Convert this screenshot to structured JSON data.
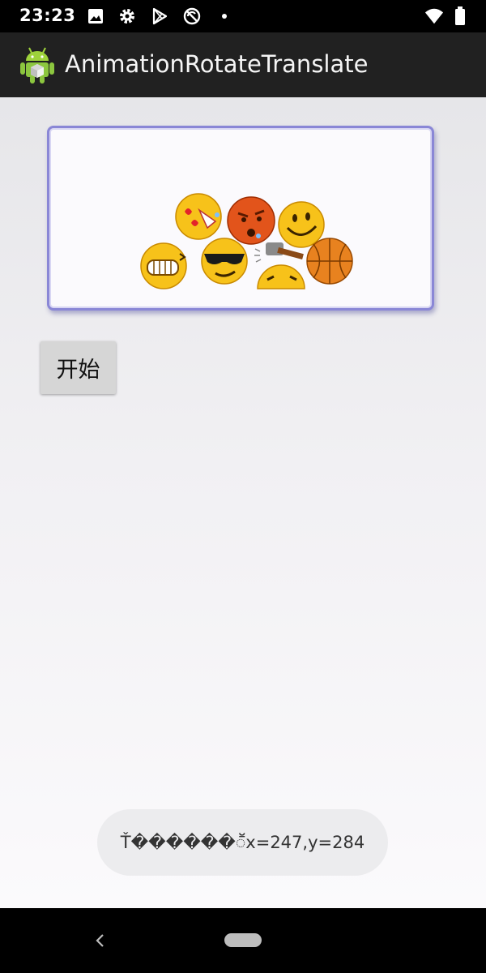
{
  "status_bar": {
    "time": "23:23",
    "left_icons": [
      "image-icon",
      "gear-icon",
      "play-store-icon",
      "no-sync-icon",
      "dot-icon"
    ],
    "right_icons": [
      "wifi-icon",
      "battery-icon"
    ]
  },
  "app_bar": {
    "title": "AnimationRotateTranslate",
    "logo": "android-logo-icon"
  },
  "main": {
    "image_frame": {
      "emojis": [
        "in-love-emoji",
        "angry-emoji",
        "smile-emoji",
        "grin-emoji",
        "cool-sunglasses-emoji",
        "hammer-hit-emoji",
        "basketball-emoji"
      ]
    },
    "start_button_label": "开始"
  },
  "toast": {
    "text": "Ť������ॕx=247,y=284"
  },
  "nav_bar": {
    "back": "back-icon",
    "home": "home-pill-icon"
  },
  "colors": {
    "status_bar": "#000000",
    "app_bar": "#212121",
    "frame_border": "#8a87d6",
    "button": "#d6d6d6",
    "toast_bg": "#ececee"
  }
}
